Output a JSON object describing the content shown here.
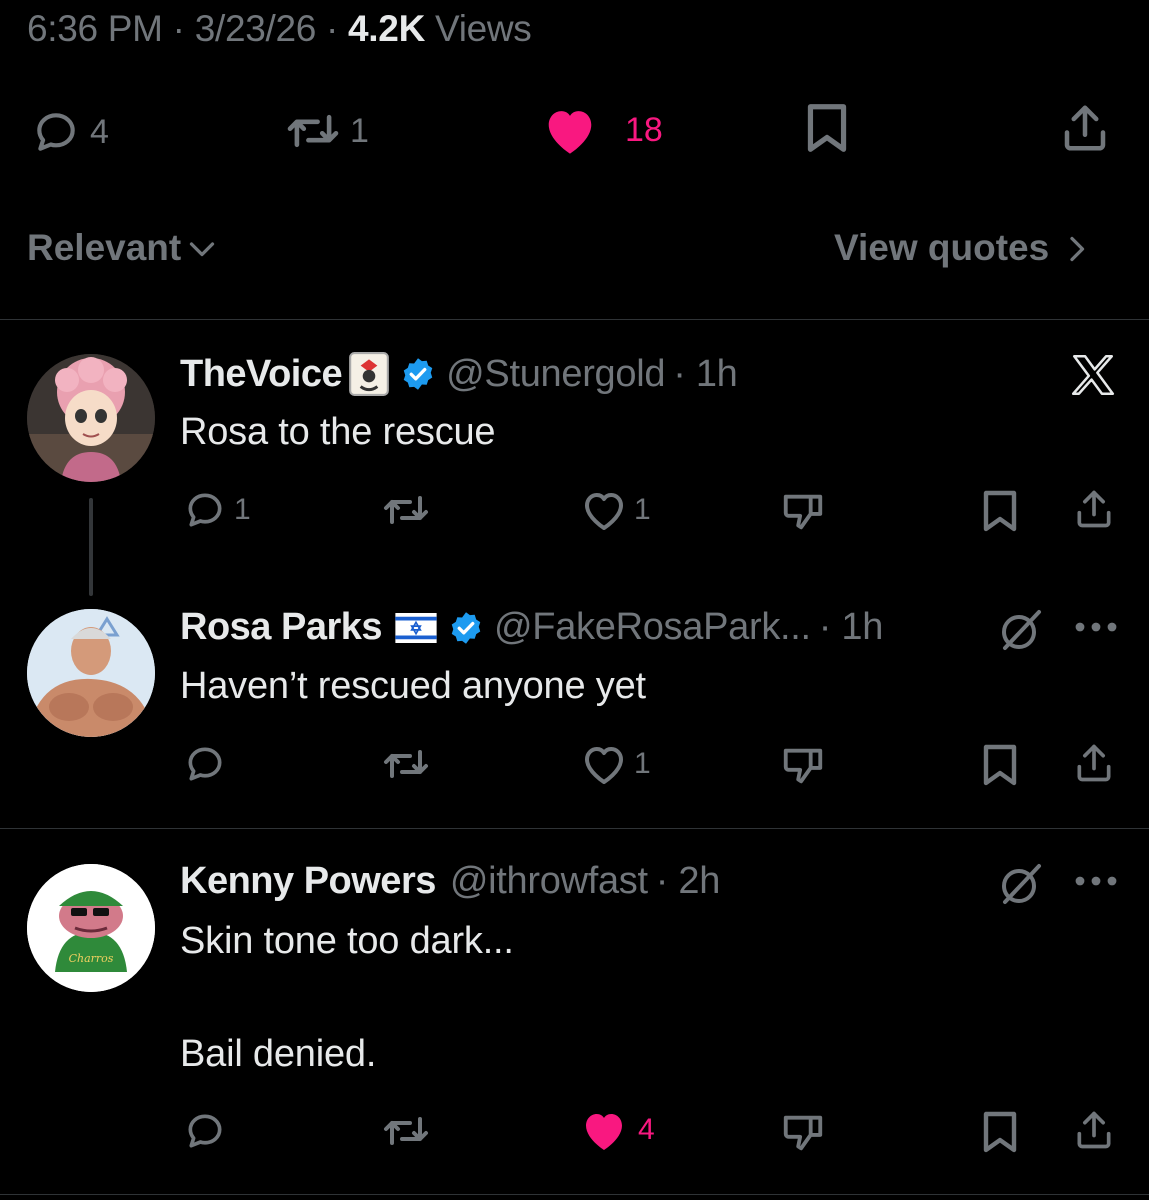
{
  "post_meta": {
    "time": "6:36 PM",
    "sep1": " · ",
    "date": "3/23/26",
    "sep2": " · ",
    "views_count": "4.2K",
    "views_label": " Views"
  },
  "post_stats": {
    "replies": "4",
    "reposts": "1",
    "likes": "18",
    "like_color": "#f91880"
  },
  "sort": {
    "label": "Relevant",
    "view_quotes": "View quotes"
  },
  "replies": [
    {
      "name": "TheVoice",
      "handle": "@Stunergold",
      "time": "· 1h",
      "text": "Rosa to the rescue",
      "reply_count": "1",
      "repost_count": "",
      "like_count": "1",
      "liked": false,
      "badge_icon": "joker-card-emoji",
      "corner_icon": "x-logo-icon"
    },
    {
      "name": "Rosa Parks",
      "handle": "@FakeRosaPark...",
      "time": "· 1h",
      "text": "Haven’t rescued anyone yet",
      "reply_count": "",
      "repost_count": "",
      "like_count": "1",
      "liked": false,
      "badge_icon": "israel-flag-emoji",
      "corner_icon": "grok-icon"
    },
    {
      "name": "Kenny Powers",
      "handle": "@ithrowfast",
      "time": "· 2h",
      "text_line1": "Skin tone too dark...",
      "text_line2": "Bail denied.",
      "reply_count": "",
      "repost_count": "",
      "like_count": "4",
      "liked": true,
      "corner_icon": "grok-icon"
    }
  ],
  "colors": {
    "background": "#000000",
    "text": "#e7e9ea",
    "muted": "#71767b",
    "verified": "#1d9bf0",
    "like": "#f91880",
    "divider": "#2f3336"
  }
}
